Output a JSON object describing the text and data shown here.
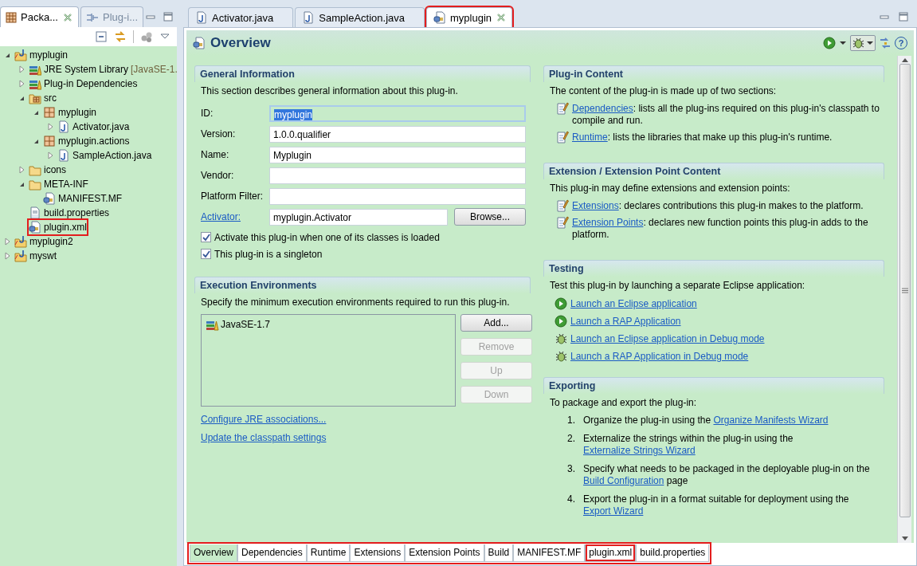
{
  "explorer": {
    "tabs": [
      {
        "label": "Packa...",
        "selected": true,
        "kind": "packages"
      },
      {
        "label": "Plug-i...",
        "selected": false,
        "kind": "plugins"
      }
    ],
    "tree": [
      {
        "label": "myplugin",
        "kind": "project",
        "expanded": true,
        "children": [
          {
            "label": "JRE System Library",
            "suffix": "[JavaSE-1.",
            "kind": "library",
            "expanded": false
          },
          {
            "label": "Plug-in Dependencies",
            "kind": "library",
            "expanded": false
          },
          {
            "label": "src",
            "kind": "source-folder",
            "expanded": true,
            "children": [
              {
                "label": "myplugin",
                "kind": "package",
                "expanded": true,
                "children": [
                  {
                    "label": "Activator.java",
                    "kind": "java-file",
                    "expanded": false
                  }
                ]
              },
              {
                "label": "myplugin.actions",
                "kind": "package",
                "expanded": true,
                "children": [
                  {
                    "label": "SampleAction.java",
                    "kind": "java-file",
                    "expanded": false
                  }
                ]
              }
            ]
          },
          {
            "label": "icons",
            "kind": "folder",
            "expanded": false
          },
          {
            "label": "META-INF",
            "kind": "folder",
            "expanded": true,
            "children": [
              {
                "label": "MANIFEST.MF",
                "kind": "plugin-file"
              }
            ]
          },
          {
            "label": "build.properties",
            "kind": "properties-file"
          },
          {
            "label": "plugin.xml",
            "kind": "plugin-file",
            "highlighted": true
          }
        ]
      },
      {
        "label": "myplugin2",
        "kind": "project",
        "expanded": false
      },
      {
        "label": "myswt",
        "kind": "project",
        "expanded": false
      }
    ]
  },
  "editor": {
    "tabs": [
      {
        "label": "Activator.java",
        "kind": "java-file",
        "selected": false,
        "highlighted": false
      },
      {
        "label": "SampleAction.java",
        "kind": "java-file",
        "selected": false,
        "highlighted": false
      },
      {
        "label": "myplugin",
        "kind": "plugin-file",
        "selected": true,
        "highlighted": true
      }
    ],
    "title": "Overview",
    "help_glyph": "?",
    "left_column": [
      {
        "kind": "form",
        "title": "General Information",
        "description": "This section describes general information about this plug-in.",
        "fields": [
          {
            "label": "ID:",
            "value": "myplugin",
            "selected": true,
            "label_link": false
          },
          {
            "label": "Version:",
            "value": "1.0.0.qualifier",
            "selected": false,
            "label_link": false
          },
          {
            "label": "Name:",
            "value": "Myplugin",
            "selected": false,
            "label_link": false
          },
          {
            "label": "Vendor:",
            "selected": false,
            "label_link": false
          },
          {
            "label": "Platform Filter:",
            "selected": false,
            "label_link": false
          },
          {
            "label": "Activator:",
            "value": "myplugin.Activator",
            "selected": false,
            "label_link": true,
            "button": "Browse..."
          }
        ],
        "checks": [
          {
            "label": "Activate this plug-in when one of its classes is loaded",
            "checked": true
          },
          {
            "label": "This plug-in is a singleton",
            "checked": true
          }
        ]
      },
      {
        "kind": "environments",
        "title": "Execution Environments",
        "description": "Specify the minimum execution environments required to run this plug-in.",
        "items": [
          "JavaSE-1.7"
        ],
        "buttons": [
          {
            "label": "Add...",
            "disabled": false
          },
          {
            "label": "Remove",
            "disabled": true
          },
          {
            "label": "Up",
            "disabled": true
          },
          {
            "label": "Down",
            "disabled": true
          }
        ],
        "links": [
          "Configure JRE associations...",
          "Update the classpath settings"
        ]
      }
    ],
    "right_column": [
      {
        "kind": "content",
        "title": "Plug-in Content",
        "description": "The content of the plug-in is made up of two sections:",
        "items": [
          {
            "link": "Dependencies",
            "text": ": lists all the plug-ins required on this plug-in's classpath to compile and run."
          },
          {
            "link": "Runtime",
            "text": ": lists the libraries that make up this plug-in's runtime."
          }
        ]
      },
      {
        "kind": "content",
        "title": "Extension / Extension Point Content",
        "description": "This plug-in may define extensions and extension points:",
        "items": [
          {
            "link": "Extensions",
            "text": ": declares contributions this plug-in makes to the platform."
          },
          {
            "link": "Extension Points",
            "text": ": declares new function points this plug-in adds to the platform."
          }
        ]
      },
      {
        "kind": "launch",
        "title": "Testing",
        "description": "Test this plug-in by launching a separate Eclipse application:",
        "links": [
          {
            "label": "Launch an Eclipse application",
            "kind": "run"
          },
          {
            "label": "Launch a RAP Application",
            "kind": "run"
          },
          {
            "label": "Launch an Eclipse application in Debug mode",
            "kind": "debug"
          },
          {
            "label": "Launch a RAP Application in Debug mode",
            "kind": "debug"
          }
        ]
      },
      {
        "kind": "steps",
        "title": "Exporting",
        "description": "To package and export the plug-in:",
        "steps": [
          {
            "number": "1.",
            "text": "Organize the plug-in using the ",
            "link": "Organize Manifests Wizard"
          },
          {
            "number": "2.",
            "text": "Externalize the strings within the plug-in using the ",
            "link": "Externalize Strings Wizard"
          },
          {
            "number": "3.",
            "text": "Specify what needs to be packaged in the deployable plug-in on the ",
            "link": "Build Configuration",
            "after": " page"
          },
          {
            "number": "4.",
            "text": "Export the plug-in in a format suitable for deployment using the ",
            "link": "Export Wizard"
          }
        ]
      }
    ],
    "page_tabs": {
      "highlighted": true,
      "tabs": [
        {
          "label": "Overview",
          "selected": true,
          "highlighted": false
        },
        {
          "label": "Dependencies",
          "selected": false,
          "highlighted": false
        },
        {
          "label": "Runtime",
          "selected": false,
          "highlighted": false
        },
        {
          "label": "Extensions",
          "selected": false,
          "highlighted": false
        },
        {
          "label": "Extension Points",
          "selected": false,
          "highlighted": false
        },
        {
          "label": "Build",
          "selected": false,
          "highlighted": false
        },
        {
          "label": "MANIFEST.MF",
          "selected": false,
          "highlighted": false
        },
        {
          "label": "plugin.xml",
          "selected": false,
          "highlighted": true
        },
        {
          "label": "build.properties",
          "selected": false,
          "highlighted": false
        }
      ]
    }
  }
}
